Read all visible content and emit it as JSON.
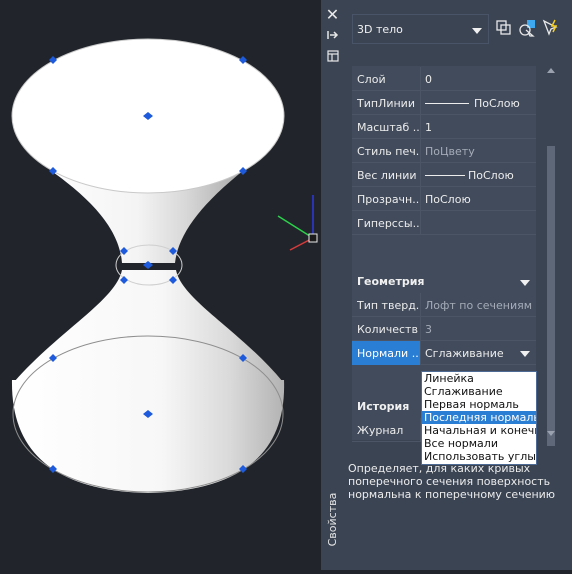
{
  "viewport": {
    "colors": {
      "background": "#21252b",
      "grip": "#1e5adc",
      "axis_x": "#d83a3a",
      "axis_y": "#2bd14a",
      "axis_z": "#2a3adf"
    }
  },
  "palette": {
    "title": "Свойства",
    "object_type": "3D тело",
    "general_properties": [
      {
        "label": "Слой",
        "value": "0"
      },
      {
        "label": "ТипЛинии",
        "value": "ПоСлою"
      },
      {
        "label": "Масштаб ...",
        "value": "1"
      },
      {
        "label": "Стиль печ...",
        "value": "ПоЦвету"
      },
      {
        "label": "Вес линии",
        "value": "ПоСлою"
      },
      {
        "label": "Прозрачн...",
        "value": "ПоСлою"
      },
      {
        "label": "Гиперссы...",
        "value": ""
      }
    ],
    "geometry": {
      "title": "Геометрия",
      "rows": [
        {
          "label": "Тип тверд...",
          "value": "Лофт по сечениям"
        },
        {
          "label": "Количеств...",
          "value": "3"
        }
      ],
      "normals_label": "Нормали ...",
      "normals_value": "Сглаживание"
    },
    "history": {
      "title": "История",
      "journal_label": "Журнал"
    },
    "dropdown_options": [
      "Линейка",
      "Сглаживание",
      "Первая нормаль",
      "Последняя нормаль",
      "Начальная и конечная нормали",
      "Все нормали",
      "Использовать углы граней"
    ],
    "description": "Определяет, для каких кривых поперечного сечения поверхность нормальна к поперечному сечению",
    "accent": "#2a7fd4"
  }
}
